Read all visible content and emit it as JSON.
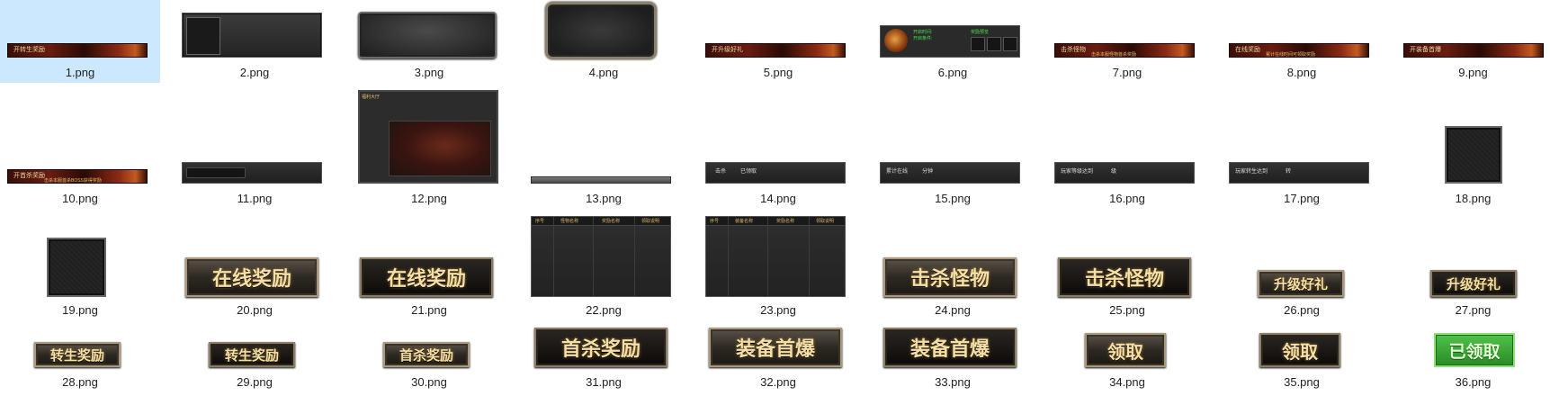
{
  "files": [
    {
      "name": "1.png",
      "kind": "banner",
      "title": "开转生奖励",
      "subtitle": "",
      "selected": true
    },
    {
      "name": "2.png",
      "kind": "darkpanel"
    },
    {
      "name": "3.png",
      "kind": "stone"
    },
    {
      "name": "4.png",
      "kind": "ornate"
    },
    {
      "name": "5.png",
      "kind": "banner",
      "title": "开升级好礼",
      "subtitle": ""
    },
    {
      "name": "6.png",
      "kind": "panel6",
      "line1": "开启时间:",
      "line2": "开启条件:",
      "line3": "奖励预览"
    },
    {
      "name": "7.png",
      "kind": "banner",
      "title": "击杀怪物",
      "subtitle": "击杀本服怪物首杀奖励"
    },
    {
      "name": "8.png",
      "kind": "banner",
      "title": "在线奖励",
      "subtitle": "累计在线时间可领取奖励"
    },
    {
      "name": "9.png",
      "kind": "banner",
      "title": "开装备首爆",
      "subtitle": ""
    },
    {
      "name": "10.png",
      "kind": "banner",
      "title": "开首杀奖励",
      "subtitle": "击杀本服首杀BOSS获得奖励"
    },
    {
      "name": "11.png",
      "kind": "bar11"
    },
    {
      "name": "12.png",
      "kind": "panel12",
      "tag": "福利大厅"
    },
    {
      "name": "13.png",
      "kind": "strip"
    },
    {
      "name": "14.png",
      "kind": "bar",
      "l1": "击杀",
      "l2": "已领取"
    },
    {
      "name": "15.png",
      "kind": "bar",
      "l1": "累计在线",
      "l2": "分钟"
    },
    {
      "name": "16.png",
      "kind": "bar",
      "l1": "玩家等级达到",
      "l2": "级"
    },
    {
      "name": "17.png",
      "kind": "bar",
      "l1": "玩家转生达到",
      "l2": "转"
    },
    {
      "name": "18.png",
      "kind": "square"
    },
    {
      "name": "19.png",
      "kind": "square"
    },
    {
      "name": "20.png",
      "kind": "btn-gold",
      "text": "在线奖励"
    },
    {
      "name": "21.png",
      "kind": "btn-dark",
      "text": "在线奖励"
    },
    {
      "name": "22.png",
      "kind": "grid",
      "h1": "序号",
      "h2": "怪物名称",
      "h3": "奖励名称",
      "h4": "领取说明"
    },
    {
      "name": "23.png",
      "kind": "grid",
      "h1": "序号",
      "h2": "装备名称",
      "h3": "奖励名称",
      "h4": "领取说明"
    },
    {
      "name": "24.png",
      "kind": "btn-gold",
      "text": "击杀怪物"
    },
    {
      "name": "25.png",
      "kind": "btn-dark",
      "text": "击杀怪物"
    },
    {
      "name": "26.png",
      "kind": "btn-gold",
      "text": "升级好礼"
    },
    {
      "name": "27.png",
      "kind": "btn-dark",
      "text": "升级好礼"
    },
    {
      "name": "28.png",
      "kind": "btn-gold",
      "text": "转生奖励"
    },
    {
      "name": "29.png",
      "kind": "btn-dark",
      "text": "转生奖励"
    },
    {
      "name": "30.png",
      "kind": "btn-gold",
      "text": "首杀奖励"
    },
    {
      "name": "31.png",
      "kind": "btn-dark",
      "text": "首杀奖励"
    },
    {
      "name": "32.png",
      "kind": "btn-gold",
      "text": "装备首爆"
    },
    {
      "name": "33.png",
      "kind": "btn-dark",
      "text": "装备首爆"
    },
    {
      "name": "34.png",
      "kind": "btn-gold",
      "text": "领取"
    },
    {
      "name": "35.png",
      "kind": "btn-dark",
      "text": "领取"
    },
    {
      "name": "36.png",
      "kind": "btn-green",
      "text": "已领取"
    }
  ]
}
